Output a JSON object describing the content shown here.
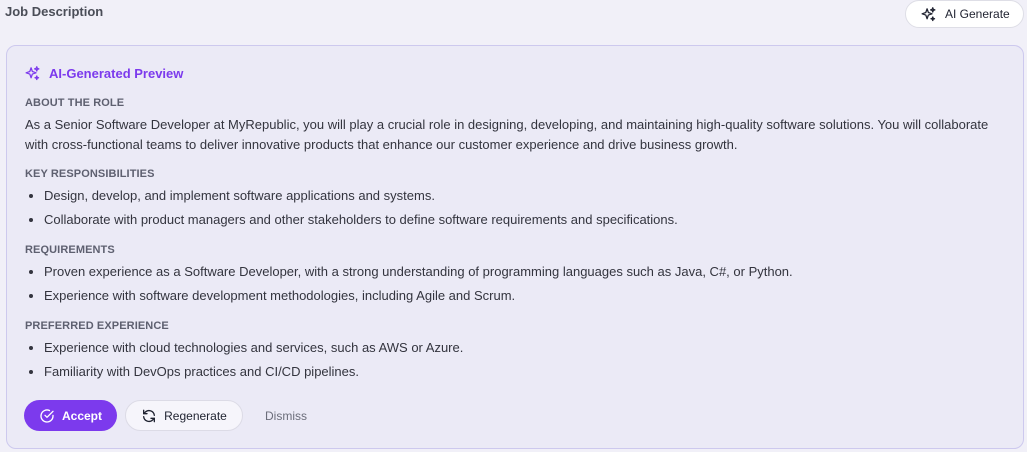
{
  "field": {
    "label": "Job Description",
    "ai_generate_label": "AI Generate"
  },
  "preview": {
    "title": "AI-Generated Preview",
    "sections": [
      {
        "heading": "ABOUT THE ROLE",
        "text": "As a Senior Software Developer at MyRepublic, you will play a crucial role in designing, developing, and maintaining high-quality software solutions. You will collaborate with cross-functional teams to deliver innovative products that enhance our customer experience and drive business growth."
      },
      {
        "heading": "KEY RESPONSIBILITIES",
        "items": [
          "Design, develop, and implement software applications and systems.",
          "Collaborate with product managers and other stakeholders to define software requirements and specifications."
        ]
      },
      {
        "heading": "REQUIREMENTS",
        "items": [
          "Proven experience as a Software Developer, with a strong understanding of programming languages such as Java, C#, or Python.",
          "Experience with software development methodologies, including Agile and Scrum."
        ]
      },
      {
        "heading": "PREFERRED EXPERIENCE",
        "items": [
          "Experience with cloud technologies and services, such as AWS or Azure.",
          "Familiarity with DevOps practices and CI/CD pipelines."
        ]
      }
    ],
    "actions": {
      "accept_label": "Accept",
      "regenerate_label": "Regenerate",
      "dismiss_label": "Dismiss"
    }
  },
  "icons": {
    "ai_generate": "sparkles-icon",
    "preview": "sparkles-icon",
    "accept": "check-circle-icon",
    "regenerate": "refresh-icon"
  },
  "colors": {
    "accent": "#7c3aed",
    "card_background": "#ebeaf6",
    "card_border": "#cdc9ee"
  }
}
